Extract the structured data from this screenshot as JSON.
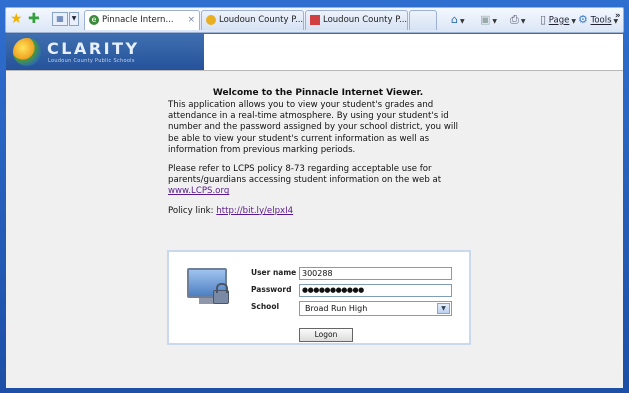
{
  "browser": {
    "tabs": [
      {
        "label": "Pinnacle Intern...",
        "close": "×"
      },
      {
        "label": "Loudoun County P..."
      },
      {
        "label": "Loudoun County P..."
      }
    ],
    "commands": [
      {
        "label": "Page"
      },
      {
        "label": "Tools"
      }
    ],
    "overflow": "»"
  },
  "logo": {
    "title": "CLARITY",
    "subtitle": "Loudoun County Public Schools"
  },
  "intro": {
    "heading": "Welcome to the Pinnacle Internet Viewer.",
    "paragraph1": "This application allows you to view your student's grades and attendance in a real-time atmosphere. By using your student's id number and the password assigned by your school district, you will be able to view your student's current information as well as information from previous marking periods.",
    "paragraph2_text": "Please refer to LCPS policy 8-73 regarding acceptable use for parents/guardians accessing student information on the web at ",
    "paragraph2_link": "www.LCPS.org",
    "policy_label": "Policy link: ",
    "policy_link": "http://bit.ly/elpxI4"
  },
  "login": {
    "username_label": "User name",
    "username_value": "300288",
    "password_label": "Password",
    "password_value": "●●●●●●●●●●●",
    "school_label": "School",
    "school_value": "Broad Run High",
    "logon_label": "Logon"
  },
  "icons": [
    "favorites-star-icon",
    "add-favorites-icon",
    "quick-tabs-icon",
    "home-icon",
    "feeds-icon",
    "print-icon",
    "page-icon",
    "tools-gear-icon",
    "computer-lock-icon"
  ],
  "colors": {
    "link": "#5a1a8c",
    "banner": "#25529a",
    "frame": "#1d4fa6"
  }
}
